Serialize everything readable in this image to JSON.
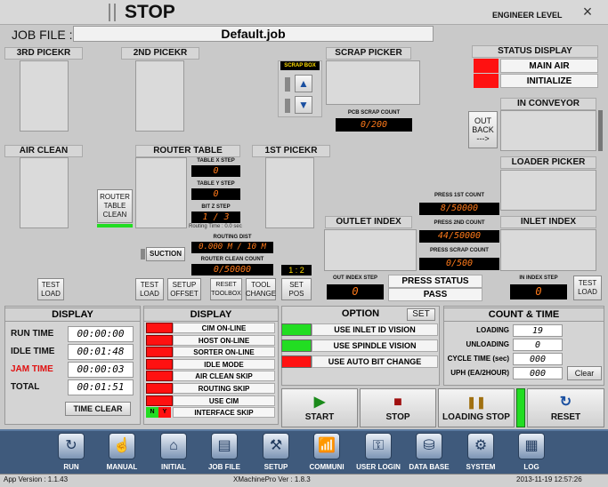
{
  "title": "STOP",
  "level": "ENGINEER LEVEL",
  "close_icon": "×",
  "job": {
    "label": "JOB FILE :",
    "value": "Default.job"
  },
  "sections": {
    "pick3": "3RD PICEKR",
    "pick2": "2ND PICEKR",
    "scrap": "SCRAP PICKER",
    "status": "STATUS DISPLAY",
    "in_conveyor": "IN CONVEYOR",
    "air_clean": "AIR CLEAN",
    "router_table": "ROUTER TABLE",
    "pick1": "1ST PICEKR",
    "loader": "LOADER PICKER",
    "outlet": "OUTLET INDEX",
    "inlet": "INLET INDEX"
  },
  "scrap_box": {
    "label": "SCRAP BOX",
    "pcb_count_label": "PCB SCRAP COUNT",
    "pcb_count": "0/200"
  },
  "status_display": {
    "items": [
      "MAIN AIR",
      "INITIALIZE"
    ],
    "color": "#ff1111"
  },
  "out_back": {
    "line1": "OUT",
    "line2": "BACK",
    "line3": "--->"
  },
  "router": {
    "x_label": "TABLE X STEP",
    "x_value": "0",
    "y_label": "TABLE Y STEP",
    "y_value": "0",
    "bitz_label": "BIT Z STEP",
    "bitz_value": "1 / 3",
    "routing_time": "Routing Time : 0.0 sec",
    "dist_label": "ROUTING DIST",
    "dist_value": "0.000 M / 10 M",
    "clean_label": "ROUTER CLEAN COUNT",
    "clean_value": "0/50000",
    "ratio": "1 : 2",
    "table_clean_btn": "ROUTER TABLE CLEAN",
    "suction": "SUCTION"
  },
  "press": {
    "first_label": "PRESS 1ST COUNT",
    "first_value": "8/50000",
    "second_label": "PRESS 2ND COUNT",
    "second_value": "44/50000",
    "scrap_label": "PRESS SCRAP COUNT",
    "scrap_value": "0/500",
    "status_label": "PRESS STATUS",
    "status_value": "PASS"
  },
  "out_index_step": {
    "label": "OUT INDEX STEP",
    "value": "0"
  },
  "in_index_step": {
    "label": "IN INDEX STEP",
    "value": "0"
  },
  "buttons": {
    "test_load_left": "TEST LOAD",
    "test_load_mid": "TEST LOAD",
    "setup_offset": "SETUP OFFSET",
    "reset_toolbox": "RESET TOOLBOX",
    "tool_change": "TOOL CHANGE",
    "set_pos": "SET POS",
    "test_load_right": "TEST LOAD"
  },
  "time_display": {
    "header": "DISPLAY",
    "rows": [
      {
        "label": "RUN TIME",
        "value": "00:00:00",
        "color": "#111111"
      },
      {
        "label": "IDLE TIME",
        "value": "00:01:48",
        "color": "#111111"
      },
      {
        "label": "JAM TIME",
        "value": "00:00:03",
        "color": "#e01010"
      },
      {
        "label": "TOTAL",
        "value": "00:01:51",
        "color": "#111111"
      }
    ],
    "clear_btn": "TIME CLEAR"
  },
  "status_list": {
    "header": "DISPLAY",
    "items": [
      "CIM ON-LINE",
      "HOST ON-LINE",
      "SORTER ON-LINE",
      "IDLE MODE",
      "AIR CLEAN SKIP",
      "ROUTING SKIP",
      "USE CIM",
      "INTERFACE SKIP"
    ],
    "interface_n": "N",
    "interface_y": "Y"
  },
  "option": {
    "header": "OPTION",
    "set_btn": "SET",
    "items": [
      {
        "label": "USE INLET ID VISION",
        "color": "#22dd22"
      },
      {
        "label": "USE SPINDLE VISION",
        "color": "#22dd22"
      },
      {
        "label": "USE AUTO BIT CHANGE",
        "color": "#ff1111"
      }
    ]
  },
  "count_time": {
    "header": "COUNT & TIME",
    "loading_label": "LOADING",
    "loading": "19",
    "unloading_label": "UNLOADING",
    "unloading": "0",
    "cycle_label": "CYCLE TIME (sec)",
    "cycle": "000",
    "uph_label": "UPH (EA/2HOUR)",
    "uph": "000",
    "clear_btn": "Clear"
  },
  "controls": {
    "start": "START",
    "stop": "STOP",
    "loading_stop": "LOADING STOP",
    "reset": "RESET",
    "start_icon": "▶",
    "stop_icon": "■",
    "pause_icon": "❚❚",
    "reset_icon": "↻"
  },
  "nav": [
    {
      "label": "RUN",
      "icon": "↻"
    },
    {
      "label": "MANUAL",
      "icon": "☝"
    },
    {
      "label": "INITIAL",
      "icon": "⌂"
    },
    {
      "label": "JOB FILE",
      "icon": "▤"
    },
    {
      "label": "SETUP",
      "icon": "⚒"
    },
    {
      "label": "COMMUNI",
      "icon": "📶"
    },
    {
      "label": "USER LOGIN",
      "icon": "⚿"
    },
    {
      "label": "DATA BASE",
      "icon": "⛁"
    },
    {
      "label": "SYSTEM",
      "icon": "⚙"
    },
    {
      "label": "LOG",
      "icon": "▦"
    }
  ],
  "statusbar": {
    "app_version": "App Version : 1.1.43",
    "xmachine": "XMachinePro Ver : 1.8.3",
    "datetime": "2013-11-19 12:57:26"
  }
}
